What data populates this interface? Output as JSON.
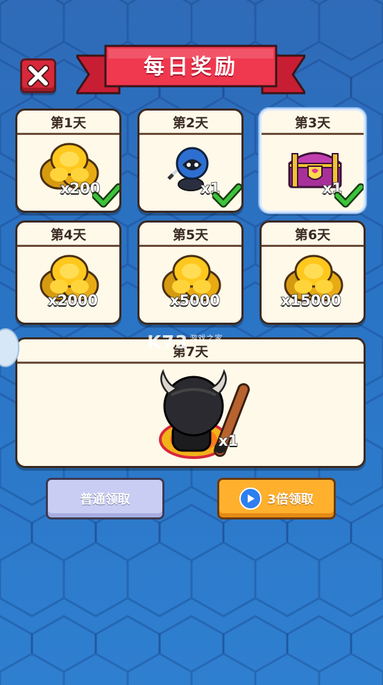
{
  "title": "每日奖励",
  "days": [
    {
      "label": "第1天",
      "reward": "coins",
      "qty": "x200",
      "claimed": true
    },
    {
      "label": "第2天",
      "reward": "hooded-ninja",
      "qty": "x1",
      "claimed": true
    },
    {
      "label": "第3天",
      "reward": "treasure-chest",
      "qty": "x1",
      "claimed": true,
      "selected": true
    },
    {
      "label": "第4天",
      "reward": "coins",
      "qty": "x2000",
      "claimed": false
    },
    {
      "label": "第5天",
      "reward": "coins",
      "qty": "x5000",
      "claimed": false
    },
    {
      "label": "第6天",
      "reward": "coins",
      "qty": "x15000",
      "claimed": false
    },
    {
      "label": "第7天",
      "reward": "viking-warrior",
      "qty": "x1",
      "claimed": false
    }
  ],
  "buttons": {
    "normal_claim": "普通领取",
    "triple_claim": "3倍领取"
  },
  "watermark": {
    "main": "K73",
    "sub": "游戏之家"
  },
  "colors": {
    "banner": "#f0384f",
    "close": "#d8283a",
    "check": "#3cc43a",
    "coin": "#ffc81e",
    "triple_button": "#ffb02d",
    "normal_button": "#c9cdf3"
  }
}
